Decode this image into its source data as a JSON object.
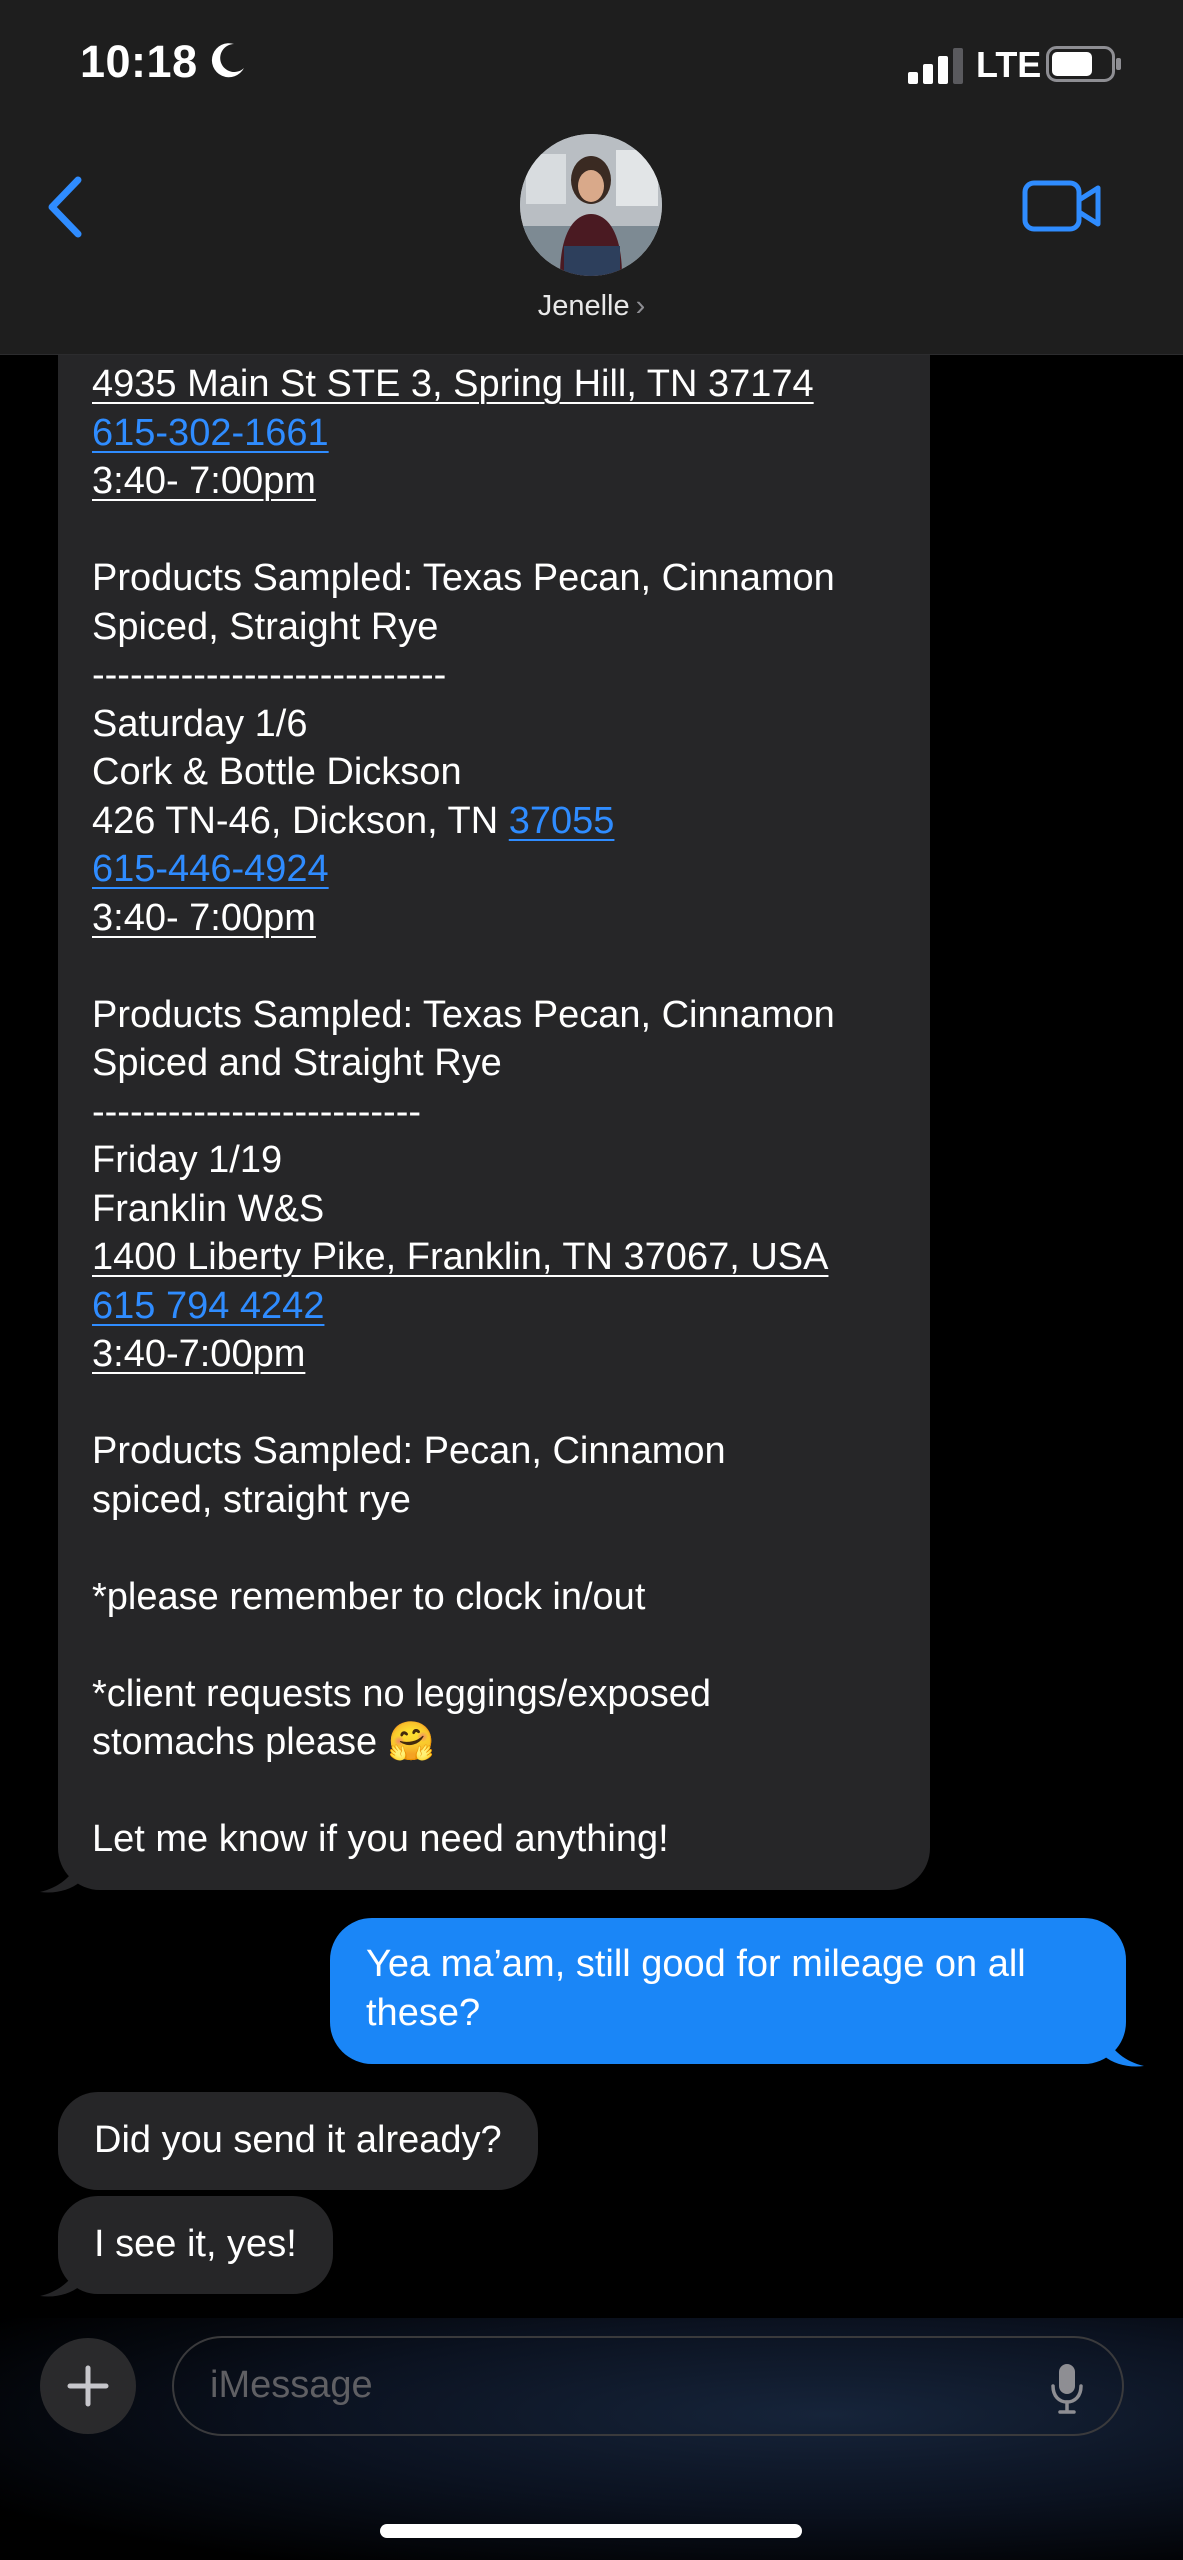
{
  "status_bar": {
    "time": "10:18",
    "network": "LTE"
  },
  "header": {
    "contact_name": "Jenelle",
    "chevron": "›"
  },
  "conversation": {
    "long_message": [
      {
        "parts": [
          {
            "t": "4935 Main St STE 3, Spring Hill, TN 37174",
            "s": "ul"
          }
        ]
      },
      {
        "parts": [
          {
            "t": "615-302-1661",
            "s": "link"
          }
        ]
      },
      {
        "parts": [
          {
            "t": "3:40- 7:00pm",
            "s": "ul"
          }
        ]
      },
      {
        "parts": []
      },
      {
        "parts": [
          {
            "t": "Products Sampled: Texas Pecan, Cinnamon",
            "s": ""
          }
        ]
      },
      {
        "parts": [
          {
            "t": "Spiced, Straight Rye",
            "s": ""
          }
        ]
      },
      {
        "parts": [
          {
            "t": "----------------------------",
            "s": ""
          }
        ]
      },
      {
        "parts": [
          {
            "t": "Saturday 1/6",
            "s": ""
          }
        ]
      },
      {
        "parts": [
          {
            "t": "Cork & Bottle Dickson",
            "s": ""
          }
        ]
      },
      {
        "parts": [
          {
            "t": "426 TN-46, Dickson, TN ",
            "s": ""
          },
          {
            "t": "37055",
            "s": "link"
          }
        ]
      },
      {
        "parts": [
          {
            "t": "615-446-4924",
            "s": "link"
          }
        ]
      },
      {
        "parts": [
          {
            "t": "3:40- 7:00pm",
            "s": "ul"
          }
        ]
      },
      {
        "parts": []
      },
      {
        "parts": [
          {
            "t": "Products Sampled: Texas Pecan, Cinnamon",
            "s": ""
          }
        ]
      },
      {
        "parts": [
          {
            "t": "Spiced and Straight Rye",
            "s": ""
          }
        ]
      },
      {
        "parts": [
          {
            "t": "--------------------------",
            "s": ""
          }
        ]
      },
      {
        "parts": [
          {
            "t": "Friday 1/19",
            "s": ""
          }
        ]
      },
      {
        "parts": [
          {
            "t": "Franklin W&S",
            "s": ""
          }
        ]
      },
      {
        "parts": [
          {
            "t": "1400 Liberty Pike, Franklin, TN 37067, USA",
            "s": "ul"
          }
        ]
      },
      {
        "parts": [
          {
            "t": "615 794 4242",
            "s": "link"
          }
        ]
      },
      {
        "parts": [
          {
            "t": "3:40-7:00pm",
            "s": "ul"
          }
        ]
      },
      {
        "parts": []
      },
      {
        "parts": [
          {
            "t": "Products Sampled: Pecan, Cinnamon",
            "s": ""
          }
        ]
      },
      {
        "parts": [
          {
            "t": "spiced, straight rye",
            "s": ""
          }
        ]
      },
      {
        "parts": []
      },
      {
        "parts": [
          {
            "t": "*please remember to clock in/out",
            "s": ""
          }
        ]
      },
      {
        "parts": []
      },
      {
        "parts": [
          {
            "t": "*client requests no leggings/exposed",
            "s": ""
          }
        ]
      },
      {
        "parts": [
          {
            "t": "stomachs please 🤗",
            "s": ""
          }
        ]
      },
      {
        "parts": []
      },
      {
        "parts": [
          {
            "t": "Let me know if you need anything!",
            "s": ""
          }
        ]
      }
    ],
    "sent_message_line1": "Yea ma’am, still good for mileage on all",
    "sent_message_line2": "these?",
    "reply1": "Did you send it already?",
    "reply2": "I see it, yes!"
  },
  "composer": {
    "placeholder": "iMessage"
  },
  "colors": {
    "accent": "#1a86f7",
    "link": "#2f8cff",
    "bubble_received": "#262628"
  },
  "icons": [
    "moon-icon",
    "signal-icon",
    "battery-icon",
    "back-chevron-icon",
    "video-call-icon",
    "plus-icon",
    "microphone-icon"
  ]
}
